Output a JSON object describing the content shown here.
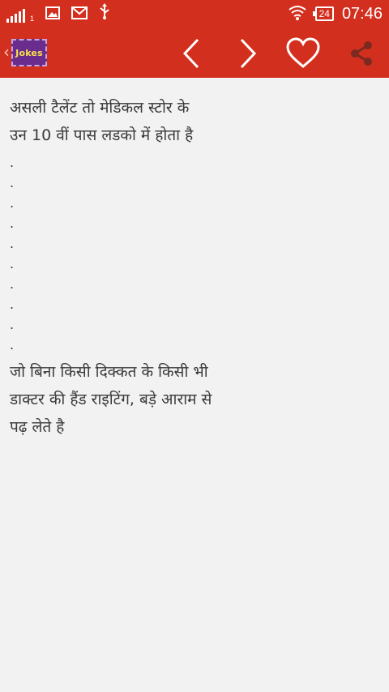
{
  "status_bar": {
    "sim_indicator": "1",
    "battery_level": "24",
    "time": "07:46",
    "icons": [
      "signal-icon",
      "image-notification-icon",
      "gmail-icon",
      "usb-icon",
      "wifi-icon",
      "battery-icon"
    ]
  },
  "app_bar": {
    "logo_text": "Jokes",
    "back_glyph": "‹",
    "actions": [
      "previous-arrow-icon",
      "next-arrow-icon",
      "favorite-heart-icon",
      "share-icon"
    ],
    "accent_color": "#d32f1e"
  },
  "joke": {
    "line_1": "असली टैलेंट तो मेडिकल स्टोर के",
    "line_2": "उन 10 वीं पास लडको में होता है",
    "dots": [
      ".",
      ".",
      ".",
      ".",
      ".",
      ".",
      ".",
      ".",
      ".",
      "."
    ],
    "line_3": "जो बिना किसी दिक्कत के किसी भी",
    "line_4": "डाक्टर की हैंड राइटिंग, बड़े आराम से",
    "line_5": "पढ़ लेते है"
  }
}
